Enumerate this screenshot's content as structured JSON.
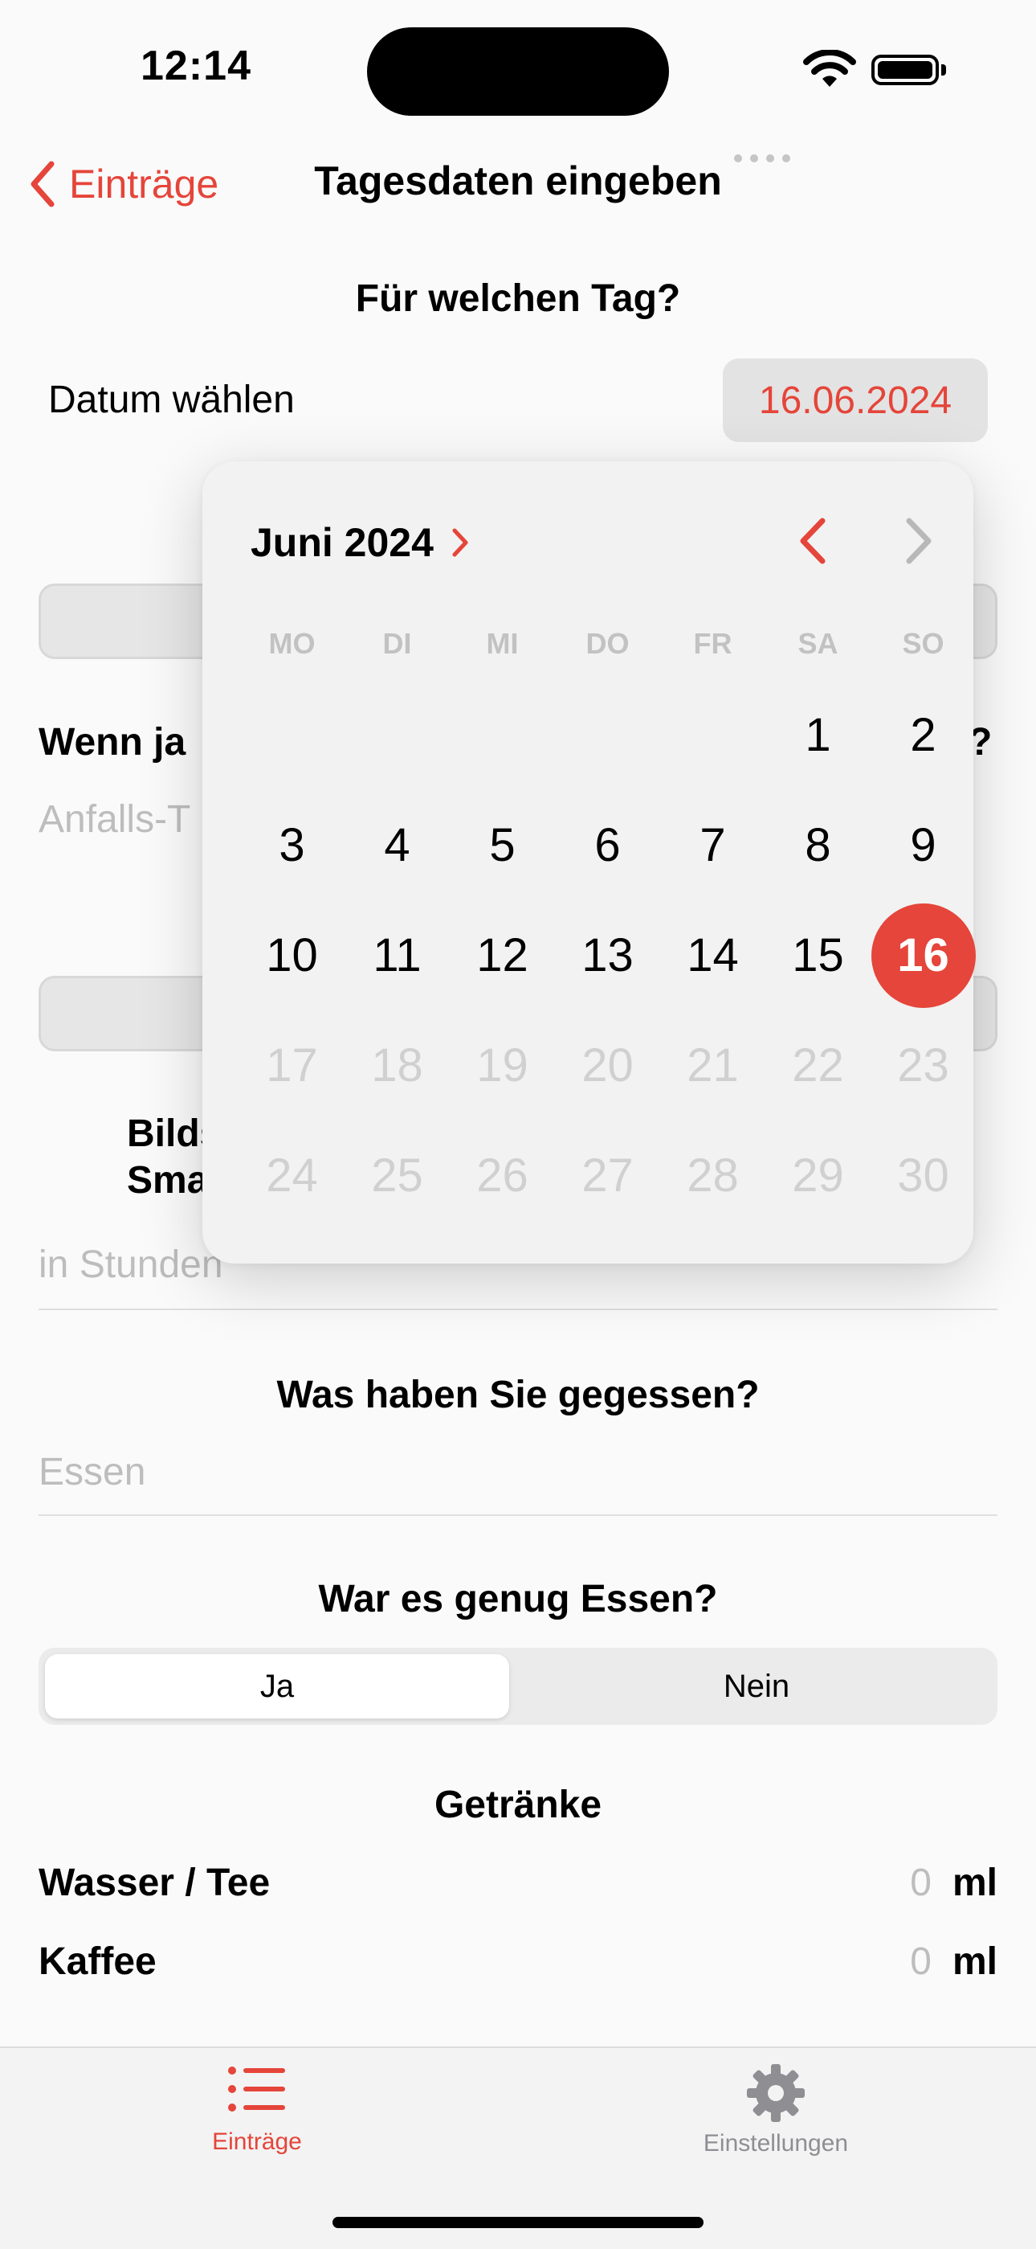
{
  "status_bar": {
    "time": "12:14"
  },
  "nav": {
    "back_label": "Einträge",
    "title": "Tagesdaten eingeben"
  },
  "date_section": {
    "title": "Für welchen Tag?",
    "label": "Datum wählen",
    "value": "16.06.2024"
  },
  "occluded": {
    "question_partial": "Wenn ja",
    "question_end": "?",
    "type_placeholder_partial": "Anfalls-T",
    "screen_label_line1_partial": "Bilds",
    "screen_label_line2_partial": "Sma",
    "hours_placeholder": "in Stunden"
  },
  "food": {
    "title": "Was haben Sie gegessen?",
    "placeholder": "Essen",
    "enough_title": "War es genug Essen?",
    "options": [
      "Ja",
      "Nein"
    ],
    "selected": "Ja"
  },
  "drinks": {
    "title": "Getränke",
    "rows": [
      {
        "name": "Wasser / Tee",
        "value": "0",
        "unit": "ml"
      },
      {
        "name": "Kaffee",
        "value": "0",
        "unit": "ml"
      }
    ]
  },
  "calendar": {
    "month_label": "Juni 2024",
    "weekdays": [
      "MO",
      "DI",
      "MI",
      "DO",
      "FR",
      "SA",
      "SO"
    ],
    "leading_blanks": 5,
    "days_in_month": 30,
    "selected_day": 16,
    "last_enabled_day": 16
  },
  "tabbar": {
    "items": [
      {
        "label": "Einträge",
        "icon": "list-icon",
        "active": true
      },
      {
        "label": "Einstellungen",
        "icon": "gear-icon",
        "active": false
      }
    ]
  },
  "colors": {
    "accent": "#e5453a",
    "placeholder": "#bdbdbd",
    "disabled_day": "#d0d0d0"
  }
}
